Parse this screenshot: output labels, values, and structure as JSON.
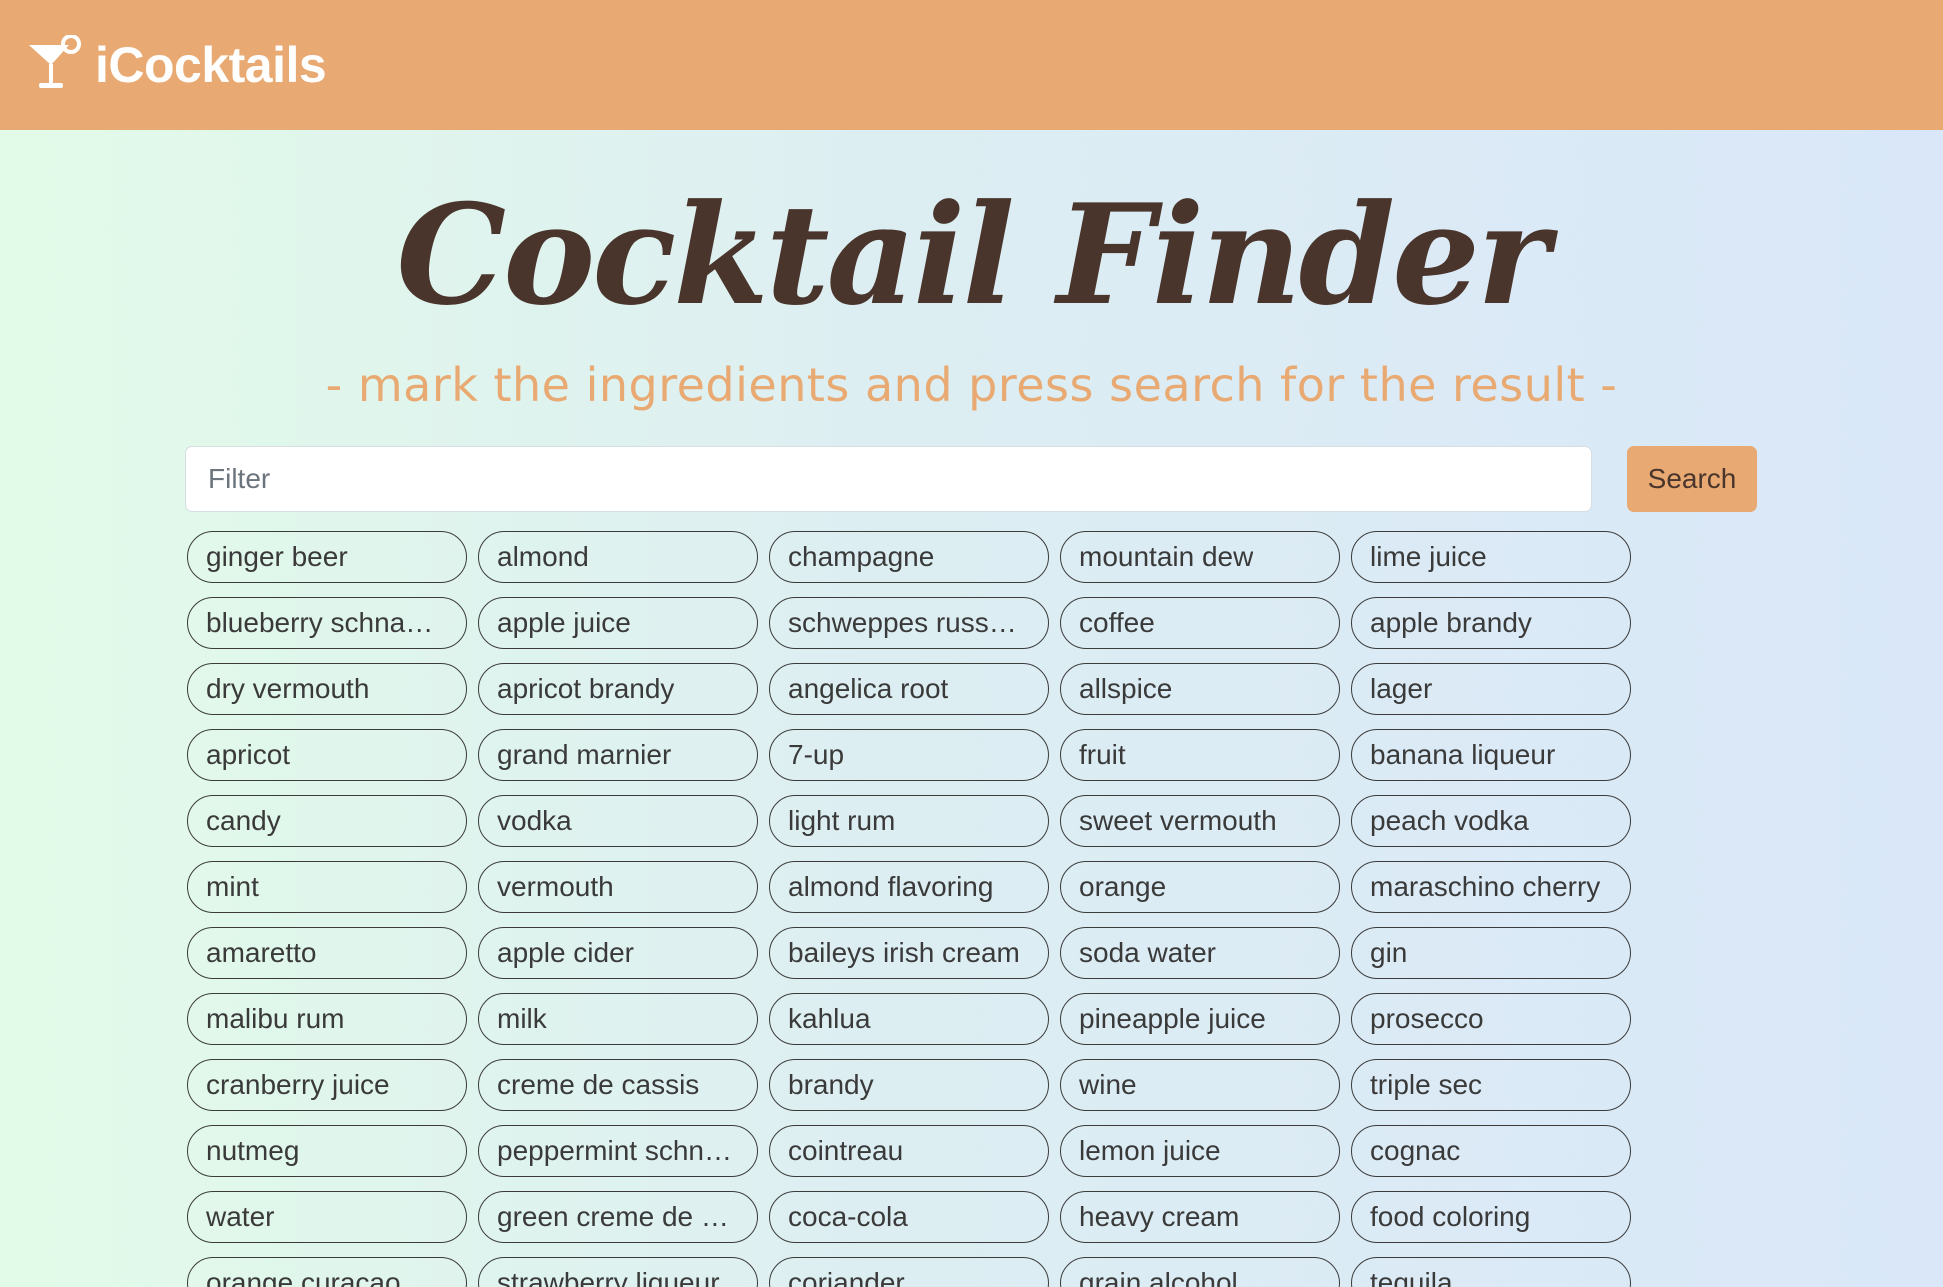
{
  "navbar": {
    "brand_name": "iCocktails",
    "brand_icon": "cocktail-glass-icon",
    "background_color": "#e8aa72"
  },
  "hero": {
    "title": "Cocktail Finder",
    "subtitle": "- mark the ingredients and press search for the result -"
  },
  "search": {
    "placeholder": "Filter",
    "value": "",
    "button_label": "Search"
  },
  "ingredients": [
    "ginger beer",
    "almond",
    "champagne",
    "mountain dew",
    "lime juice",
    "blueberry schna…",
    "apple juice",
    "schweppes russ…",
    "coffee",
    "apple brandy",
    "dry vermouth",
    "apricot brandy",
    "angelica root",
    "allspice",
    "lager",
    "apricot",
    "grand marnier",
    "7-up",
    "fruit",
    "banana liqueur",
    "candy",
    "vodka",
    "light rum",
    "sweet vermouth",
    "peach vodka",
    "mint",
    "vermouth",
    "almond flavoring",
    "orange",
    "maraschino cherry",
    "amaretto",
    "apple cider",
    "baileys irish cream",
    "soda water",
    "gin",
    "malibu rum",
    "milk",
    "kahlua",
    "pineapple juice",
    "prosecco",
    "cranberry juice",
    "creme de cassis",
    "brandy",
    "wine",
    "triple sec",
    "nutmeg",
    "peppermint schn…",
    "cointreau",
    "lemon juice",
    "cognac",
    "water",
    "green creme de …",
    "coca-cola",
    "heavy cream",
    "food coloring",
    "orange curacao",
    "strawberry liqueur",
    "coriander",
    "grain alcohol",
    "tequila"
  ],
  "colors": {
    "accent": "#e8aa72",
    "title": "#4a352d",
    "pill_border": "#3b3b3b"
  }
}
